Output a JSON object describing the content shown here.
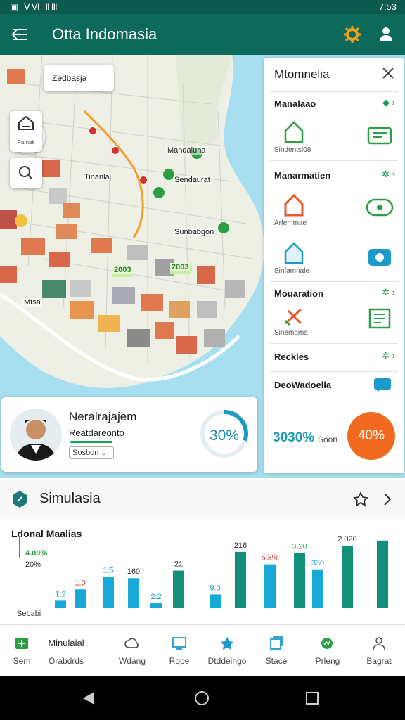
{
  "status_bar": {
    "left_icons": "▣ ⅤⅥ ⅡⅢ",
    "time": "7:53"
  },
  "app_bar": {
    "title": "Otta Indomasia",
    "menu_icon": "menu-icon",
    "settings_icon": "gear-icon",
    "profile_icon": "user-icon"
  },
  "map": {
    "pin_card_label": "Zedbasja",
    "tools": [
      {
        "label": "Pamak"
      },
      {
        "label": ""
      }
    ],
    "labels": [
      "Mandaluha",
      "Tinanlaj",
      "Sendaurat",
      "Sunbabgon",
      "2003",
      "2003",
      "Mtsa"
    ],
    "accent_green": "#2e9e44",
    "route_color": "#f0a030"
  },
  "side_panel": {
    "title": "Mtomnelia",
    "sections": [
      {
        "title": "Manalaao",
        "tiles": [
          {
            "label": "Sindentsi08"
          },
          {
            "label": ""
          }
        ]
      },
      {
        "title": "Manarmatien",
        "tiles": [
          {
            "label": "Arfemmae"
          },
          {
            "label": ""
          },
          {
            "label": "Sinfamnale"
          },
          {
            "label": ""
          }
        ]
      },
      {
        "title": "Mouaration",
        "tiles": [
          {
            "label": "Sinemoma"
          },
          {
            "label": ""
          }
        ]
      },
      {
        "title": "Reckles",
        "tiles": []
      },
      {
        "title": "DeoWadoelia",
        "tiles": []
      }
    ]
  },
  "profile": {
    "name": "Neralrajajem",
    "role": "Reatdareonto",
    "select_value": "Sosbon"
  },
  "progress_small": {
    "value_label": "30%",
    "value": 0.3
  },
  "stats": {
    "big": "3030%",
    "small": "Soon",
    "orange_label": "40%",
    "orange_color": "#f26a20"
  },
  "chart_panel": {
    "title": "Simulasia",
    "subtitle": "Ldonal Maalias",
    "notes": {
      "left_value": "4.00%",
      "left_sub": "20%",
      "left_bottom": "Sebabi"
    },
    "chart_data": {
      "type": "bar",
      "series": [
        {
          "name": "",
          "color": "#19a9d9",
          "values": [
            12,
            30,
            50,
            48,
            8,
            22,
            70,
            62
          ]
        },
        {
          "name": "",
          "color": "#12907a",
          "values": [
            60,
            90,
            88,
            100,
            108
          ]
        }
      ],
      "data_labels": [
        "1:2",
        "1.0",
        "1:5",
        "160",
        "2:2",
        "21",
        "9.0",
        "216",
        "5.3%",
        "3.20",
        "330",
        "2.020"
      ]
    }
  },
  "bottom_nav": [
    {
      "label": "Sem",
      "icon": "grid-icon"
    },
    {
      "label": "Orabdrds",
      "title": "Minulaial",
      "icon": ""
    },
    {
      "label": "Wdang",
      "icon": "cloud-icon"
    },
    {
      "label": "Rope",
      "icon": "monitor-icon"
    },
    {
      "label": "Dtddeingo",
      "icon": "star-icon"
    },
    {
      "label": "Stace",
      "icon": "cube-icon"
    },
    {
      "label": "Prleng",
      "icon": "chart-icon"
    },
    {
      "label": "Bagrat",
      "icon": "person-icon"
    }
  ]
}
